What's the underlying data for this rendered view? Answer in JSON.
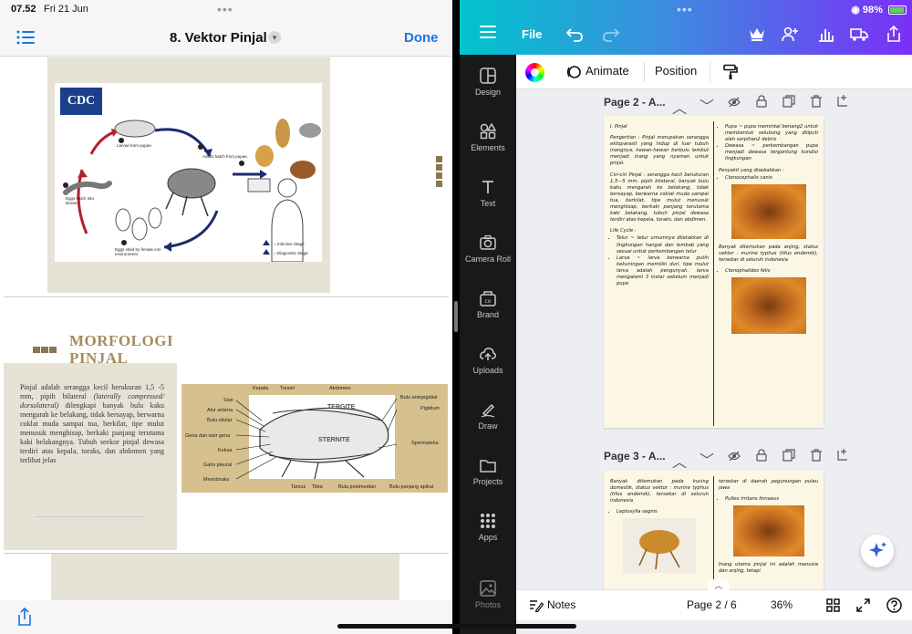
{
  "status": {
    "time": "07.52",
    "date": "Fri 21 Jun",
    "battery": "98%"
  },
  "viewer": {
    "title": "8. Vektor Pinjal",
    "done_label": "Done",
    "page1": {
      "logo": "CDC",
      "captions": {
        "larvae": "Larvae form pupae.",
        "adults": "Adults hatch from pupae.",
        "eggs_hatch": "Eggs hatch into larvae.",
        "eggs_shed": "Eggs shed by female into environment.",
        "infective": "= Infective Stage",
        "diagnostic": "= Diagnostic Stage"
      }
    },
    "page2": {
      "title": "MORFOLOGI PINJAL",
      "body_a": "Pinjal adalah serangga kecil berukuran 1,5 -5 mm, pipih bilateral ",
      "body_b": "(laterally compressed/ dorsolateral)",
      "body_c": " dilengkapi banyak bulu kaku mengarah ke belakang, tidak bersayap, berwarna coklat muda sampai tua, berkilat, tipe mulut menusuk menghisap, berkaki panjang terutama kaki belakangnya. Tubuh seekor pinjal dewasa terdiri atas kepala, toraks, dan abdomen yang terlihat jelas",
      "labels": {
        "kepala": "Kepala",
        "torsiel": "Torsiel",
        "abdomen": "Abdomen",
        "bulu_antepigidial": "Bulu antepigidial",
        "pigidium": "Pigidium",
        "spermateka": "Spermateka",
        "sisir": "Sisir",
        "alur_antena": "Alur antena",
        "bulu_okular": "Bulu okular",
        "gena": "Gena dan sisir gena",
        "koksa": "Koksa",
        "garis_pleural": "Garis pleural",
        "mesotoraks": "Mesotoraks",
        "tarsus": "Tarsus",
        "tibia": "Tibia",
        "bulu_postmedian": "Bulu postmedian",
        "bulu_panjang_apikal": "Bulu panjang apikal",
        "tergite": "TERGITE",
        "sternite": "STERNITE"
      }
    }
  },
  "canva": {
    "menu": {
      "file": "File"
    },
    "props": {
      "animate": "Animate",
      "position": "Position"
    },
    "sidebar": [
      {
        "label": "Design",
        "icon": "design-icon"
      },
      {
        "label": "Elements",
        "icon": "elements-icon"
      },
      {
        "label": "Text",
        "icon": "text-icon"
      },
      {
        "label": "Camera Roll",
        "icon": "camera-icon"
      },
      {
        "label": "Brand",
        "icon": "brand-icon"
      },
      {
        "label": "Uploads",
        "icon": "uploads-icon"
      },
      {
        "label": "Draw",
        "icon": "draw-icon"
      },
      {
        "label": "Projects",
        "icon": "projects-icon"
      },
      {
        "label": "Apps",
        "icon": "apps-icon"
      },
      {
        "label": "Photos",
        "icon": "photos-icon"
      }
    ],
    "page2": {
      "header": "Page 2 - A...",
      "left": {
        "heading": "I. Pinjal",
        "p1": "Pengertian : Pinjal merupakan serangga ektoparasit yang hidup di luar tubuh inangnya, hewan-hewan berbulu lembut menjadi inang yang nyaman untuk pinjal.",
        "p2": "Ciri-ciri Pinjal : serangga kecil berukuran 1,5—5 mm, pipih bilateral, banyak bulu kaku mengarah ke belakang, tidak bersayap, berwarna coklat muda sampai tua, berkilat, tipe mulut menusuk menghisap, berkaki panjang terutama kaki belakang, tubuh pinjal dewasa terdiri atas kepala, toraks, dan abdimen.",
        "life_cycle": "Life Cycle :",
        "b1": "Telur ~ telur umumnya diletakkan di lingkungan hangat dan lembab yang sesuai untuk perkembangan telur",
        "b2": "Larva ~ larva berwarna putih kekuningan memiliki duri, tipe mulut larva adalah pengunyah. larva mengalami 3 instar sebelum menjadi pupa"
      },
      "right": {
        "b1": "Pupa ~ pupa memintal benang2 untuk membentuk selubung yang diliputi oleh serpihan2 debris",
        "b2": "Dewasa ~ perkembangan pupa menjadi dewasa tergantung kondisi lingkungan",
        "penyakit": "Penyakit yang disebabkan :",
        "sp1": "Ctenocephalis canis",
        "p1": "Banyak ditemukan pada anjing, status vektor : murine typhus (tifus endemik), tersebar di seluruh indonesia",
        "sp2": "Ctenophalides felis"
      }
    },
    "page3": {
      "header": "Page 3 - A...",
      "left": {
        "p1": "Banyak ditemukan pada kucing domestik, status vektor : murine typhus (tifus endemik), tersebar di seluruh indonesia",
        "sp1": "Leptosylla segnis"
      },
      "right": {
        "p1": "tersebar di daerah pegunungan pulau jawa",
        "sp1": "Pullex irritans linnaeus",
        "p2": "Inang utama pinjal ini adalah manusia dan anjing, tetapi"
      }
    },
    "bottom": {
      "notes": "Notes",
      "page_indicator": "Page 2 / 6",
      "zoom": "36%"
    }
  },
  "colors": {
    "canva_gradient_start": "#00c4cc",
    "canva_gradient_end": "#7b2ff7",
    "accent_blue": "#1a73e8",
    "beige": "#e6e2d6",
    "brown": "#8c7650"
  }
}
